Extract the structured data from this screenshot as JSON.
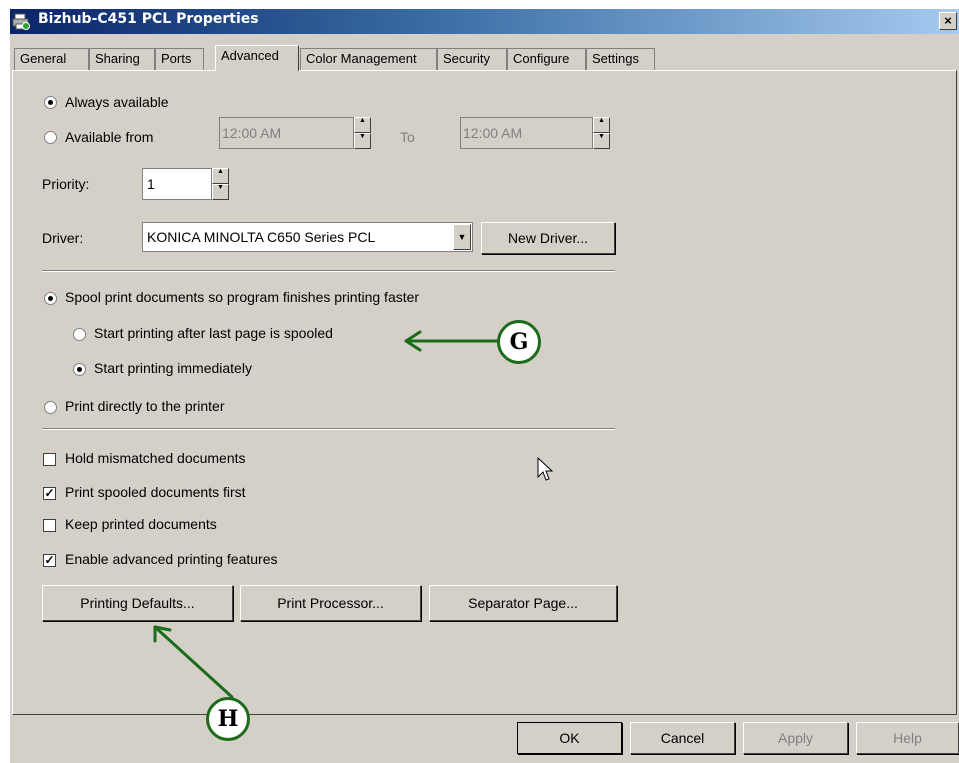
{
  "window": {
    "title": "Bizhub-C451 PCL Properties",
    "close_label": "×"
  },
  "tabs": [
    {
      "label": "General"
    },
    {
      "label": "Sharing"
    },
    {
      "label": "Ports"
    },
    {
      "label": "Advanced"
    },
    {
      "label": "Color Management"
    },
    {
      "label": "Security"
    },
    {
      "label": "Configure"
    },
    {
      "label": "Settings"
    }
  ],
  "active_tab": "Advanced",
  "availability": {
    "always_label": "Always available",
    "from_label": "Available from",
    "from_time": "12:00 AM",
    "to_label": "To",
    "to_time": "12:00 AM",
    "selected": "always"
  },
  "priority": {
    "label": "Priority:",
    "value": "1"
  },
  "driver": {
    "label": "Driver:",
    "value": "KONICA MINOLTA C650 Series PCL",
    "new_driver_label": "New Driver..."
  },
  "spooling": {
    "spool_label": "Spool print documents so program finishes printing faster",
    "after_last_label": "Start printing after last page is spooled",
    "immediately_label": "Start printing immediately",
    "direct_label": "Print directly to the printer",
    "selected": "spool",
    "start_mode": "immediately"
  },
  "options": [
    {
      "label": "Hold mismatched documents",
      "checked": false
    },
    {
      "label": "Print spooled documents first",
      "checked": true
    },
    {
      "label": "Keep printed documents",
      "checked": false
    },
    {
      "label": "Enable advanced printing features",
      "checked": true
    }
  ],
  "buttons": {
    "printing_defaults": "Printing Defaults...",
    "print_processor": "Print Processor...",
    "separator_page": "Separator Page...",
    "ok": "OK",
    "cancel": "Cancel",
    "apply": "Apply",
    "help": "Help"
  },
  "annotations": {
    "g": "G",
    "h": "H",
    "color": "#1a6b1a"
  }
}
